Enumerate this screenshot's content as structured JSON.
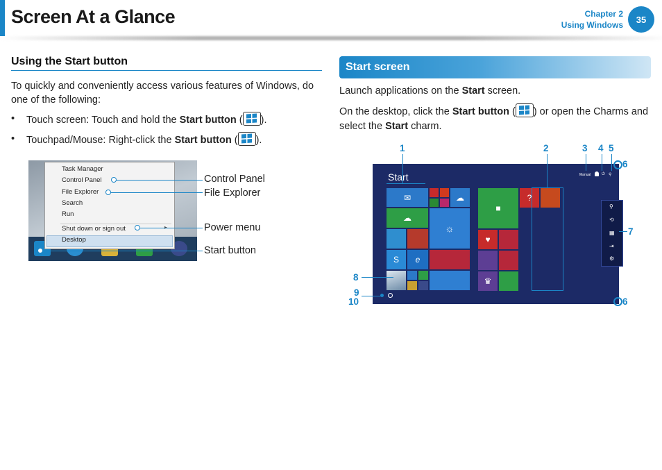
{
  "header": {
    "title": "Screen At a Glance",
    "chapter": "Chapter 2",
    "section": "Using Windows",
    "page_number": "35"
  },
  "left": {
    "heading": "Using the Start button",
    "intro": "To quickly and conveniently access various features of Windows, do one of the following:",
    "bullets": [
      {
        "prefix": "Touch screen: Touch and hold the ",
        "bold": "Start button",
        "open": " (",
        "close": ")."
      },
      {
        "prefix": "Touchpad/Mouse: Right-click the ",
        "bold": "Start button",
        "open": " (",
        "close": ")."
      }
    ],
    "context_menu": {
      "items": [
        "Task Manager",
        "Control Panel",
        "File Explorer",
        "Search",
        "Run",
        "Shut down or sign out",
        "Desktop"
      ]
    },
    "callouts": [
      "Control Panel",
      "File Explorer",
      "Power menu",
      "Start button"
    ]
  },
  "right": {
    "heading": "Start screen",
    "para1_prefix": "Launch applications on the ",
    "para1_bold": "Start",
    "para1_suffix": " screen.",
    "para2_prefix": "On the desktop, click the ",
    "para2_bold": "Start button",
    "para2_middle": " (",
    "para2_after_icon": ") or open the Charms and select the ",
    "para2_bold2": "Start",
    "para2_suffix": " charm.",
    "screen_title": "Start",
    "user_name": "Manual",
    "numbers": [
      "1",
      "2",
      "3",
      "4",
      "5",
      "6",
      "7",
      "8",
      "9",
      "10",
      "6"
    ]
  },
  "colors": {
    "accent": "#1b86c7",
    "start_background": "#1c2a66"
  }
}
